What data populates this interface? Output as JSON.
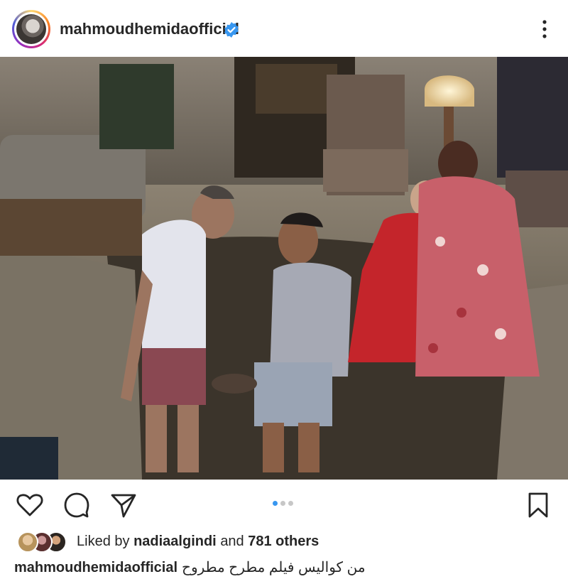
{
  "post": {
    "username": "mahmoudhemidaofficial",
    "verified": true,
    "avatar_icon": "profile-photo",
    "more_icon": "more-vertical-icon"
  },
  "photo": {
    "carousel_count": 3,
    "carousel_active": 1
  },
  "actions": {
    "like_icon": "heart-icon",
    "comment_icon": "comment-icon",
    "share_icon": "send-icon",
    "save_icon": "bookmark-icon"
  },
  "likes": {
    "prefix": "Liked by",
    "user": "nadiaalgindi",
    "connector": "and",
    "others": "781 others"
  },
  "caption": {
    "username": "mahmoudhemidaofficial",
    "text": "من كواليس فيلم مطرح مطروح"
  },
  "colors": {
    "verified_blue": "#3897f0",
    "text": "#262626",
    "carousel_active": "#3897f0",
    "carousel_inactive": "#c7c7c7"
  }
}
